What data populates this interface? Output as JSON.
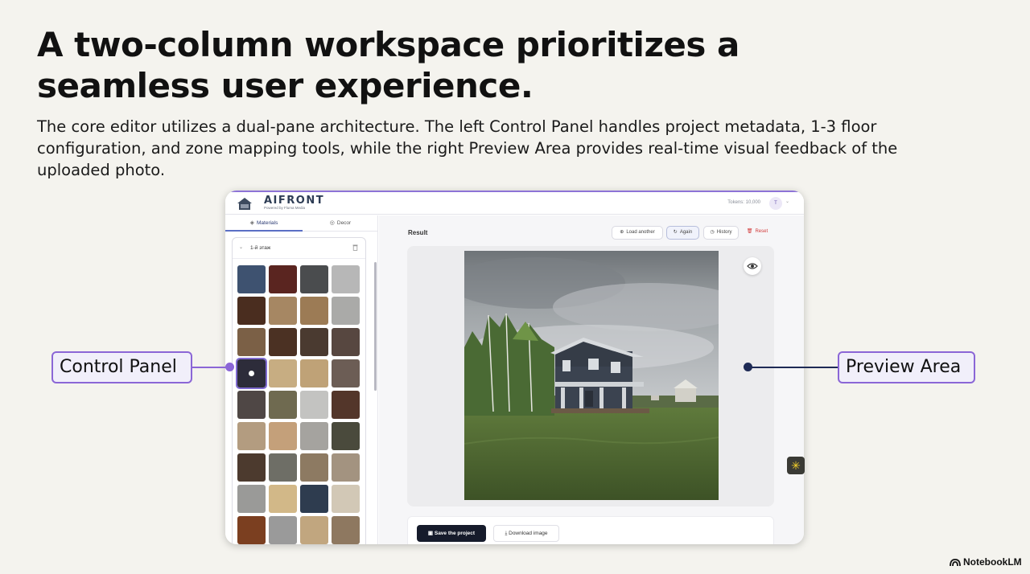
{
  "slide": {
    "title": "A two-column workspace prioritizes a seamless user experience.",
    "body": "The core editor utilizes a dual-pane architecture. The left Control Panel handles project metadata, 1-3 floor configuration, and zone mapping tools, while the right Preview Area provides real-time visual feedback of the uploaded photo."
  },
  "callouts": {
    "left": "Control Panel",
    "right": "Preview Area"
  },
  "app": {
    "logo": "AIFRONT",
    "logo_sub": "Powered by Fluma Media",
    "tokens": "Tokens: 10,000",
    "avatar": "T",
    "tabs": [
      {
        "label": "Materials",
        "icon": "layers-icon",
        "active": true
      },
      {
        "label": "Decor",
        "icon": "palette-icon",
        "active": false
      }
    ],
    "zone": {
      "title": "1-й этаж"
    },
    "swatches": [
      {
        "color": "#3e5270"
      },
      {
        "color": "#5a2520"
      },
      {
        "color": "#4a4c4e"
      },
      {
        "color": "#b7b7b7"
      },
      {
        "color": "#4a2d1f"
      },
      {
        "color": "#a68763"
      },
      {
        "color": "#9c7b55"
      },
      {
        "color": "#aaaaa8"
      },
      {
        "color": "#7b6046"
      },
      {
        "color": "#4b3123"
      },
      {
        "color": "#4a3a30"
      },
      {
        "color": "#574740"
      },
      {
        "color": "#2d2c3a",
        "selected": true
      },
      {
        "color": "#c7ad82"
      },
      {
        "color": "#bfa277"
      },
      {
        "color": "#6c5d55"
      },
      {
        "color": "#4f4745"
      },
      {
        "color": "#6f6a50"
      },
      {
        "color": "#c3c3c1"
      },
      {
        "color": "#53362a"
      },
      {
        "color": "#b39c80"
      },
      {
        "color": "#c4a07a"
      },
      {
        "color": "#a5a39f"
      },
      {
        "color": "#4a4a3c"
      },
      {
        "color": "#4c3a2e"
      },
      {
        "color": "#6e6e66"
      },
      {
        "color": "#8d7a62"
      },
      {
        "color": "#a39380"
      },
      {
        "color": "#9a9a98"
      },
      {
        "color": "#d2b888"
      },
      {
        "color": "#2e3c4f"
      },
      {
        "color": "#d2c8b6"
      },
      {
        "color": "#7b3f20"
      },
      {
        "color": "#9a9a9a"
      },
      {
        "color": "#c1a67f"
      },
      {
        "color": "#8e7860"
      }
    ],
    "result_label": "Result",
    "buttons": {
      "load_another": "Load another",
      "again": "Again",
      "history": "History",
      "reset": "Reset"
    },
    "save": "Save the project",
    "download": "Download image"
  },
  "brand": "NotebookLM",
  "colors": {
    "accent": "#8b66d6",
    "navy": "#1e2a55",
    "reset": "#d23a3a"
  }
}
